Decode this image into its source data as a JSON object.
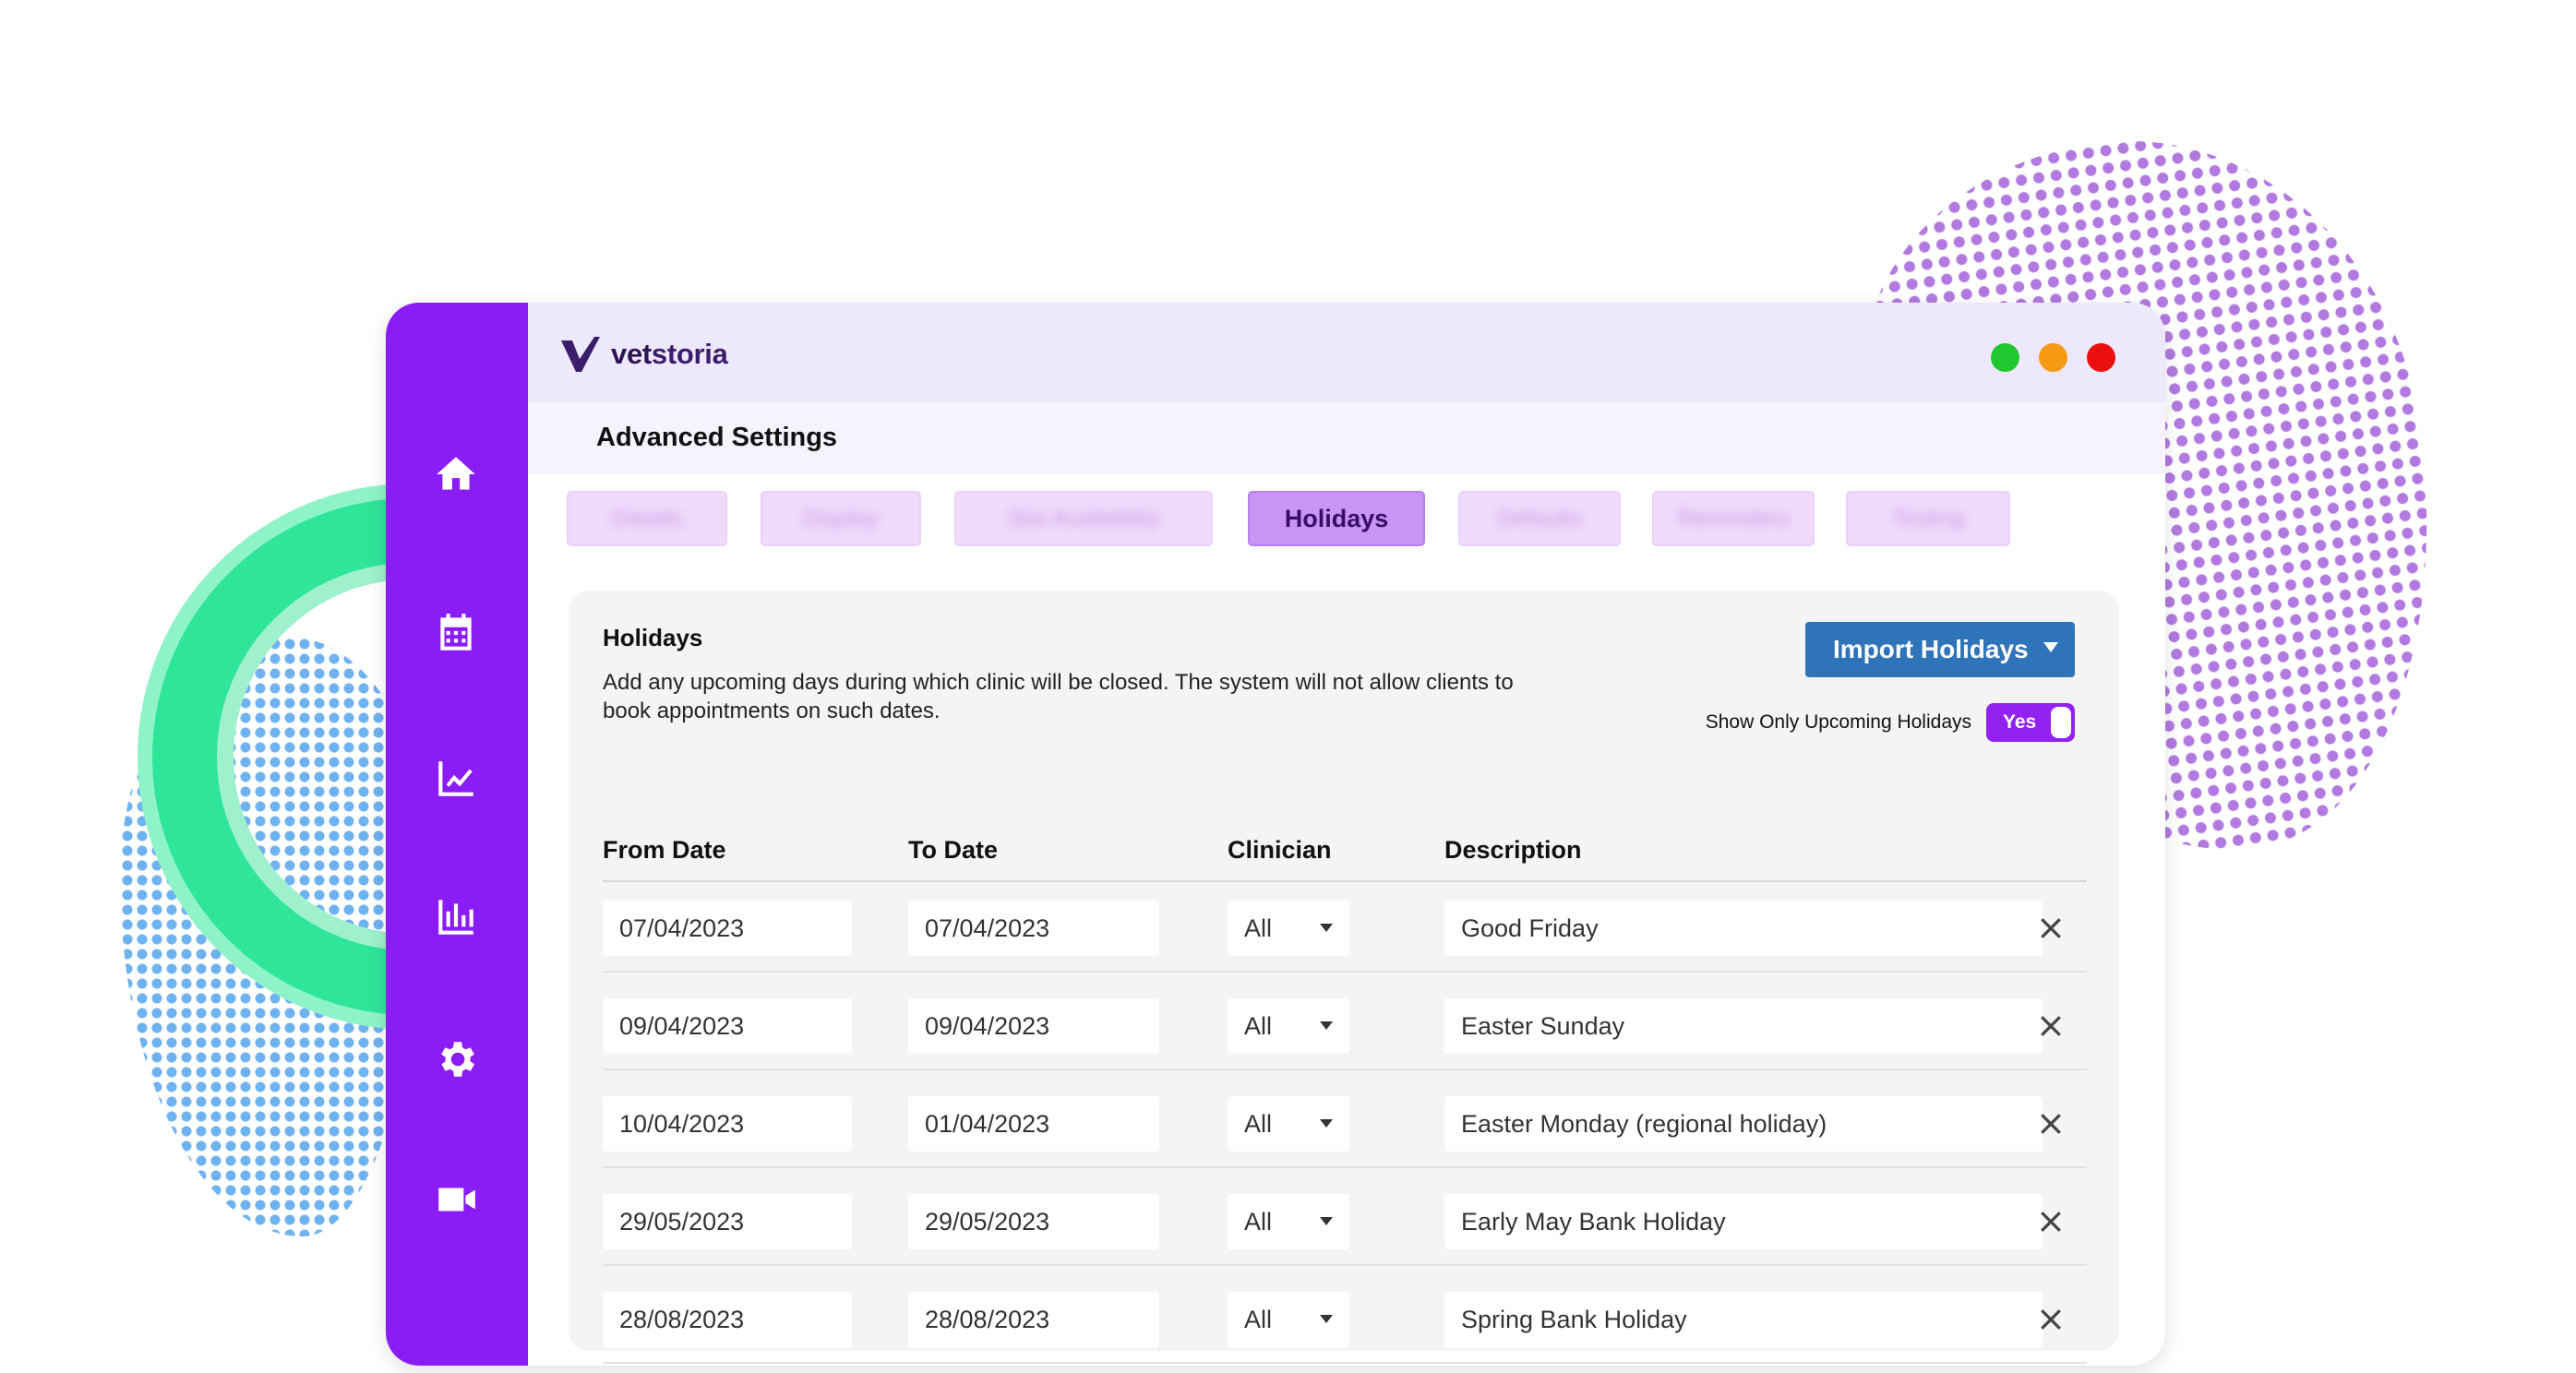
{
  "app": {
    "brand_pre": "vet",
    "brand_post": "storia"
  },
  "window_controls": [
    {
      "name": "green",
      "color": "#20c72f"
    },
    {
      "name": "orange",
      "color": "#f59a12"
    },
    {
      "name": "red",
      "color": "#ea1010"
    }
  ],
  "sidebar": {
    "items": [
      {
        "icon": "home-icon"
      },
      {
        "icon": "calendar-icon"
      },
      {
        "icon": "analytics-icon"
      },
      {
        "icon": "bar-chart-icon"
      },
      {
        "icon": "gear-icon"
      },
      {
        "icon": "video-icon"
      }
    ]
  },
  "page": {
    "title": "Advanced Settings"
  },
  "tabs": [
    {
      "label": "Details",
      "active": false
    },
    {
      "label": "Display",
      "active": false
    },
    {
      "label": "Slot Availability",
      "active": false
    },
    {
      "label": "Holidays",
      "active": true
    },
    {
      "label": "Defaults",
      "active": false
    },
    {
      "label": "Reminders",
      "active": false
    },
    {
      "label": "Testing",
      "active": false
    }
  ],
  "holidays": {
    "title": "Holidays",
    "description": "Add any upcoming days during which clinic will be closed. The system will not allow clients to book appointments on such dates.",
    "import_button": "Import Holidays",
    "upcoming_label": "Show Only Upcoming Holidays",
    "upcoming_toggle": "Yes",
    "columns": {
      "from": "From Date",
      "to": "To Date",
      "clinician": "Clinician",
      "description": "Description"
    },
    "rows": [
      {
        "from": "07/04/2023",
        "to": "07/04/2023",
        "clinician": "All",
        "description": "Good Friday"
      },
      {
        "from": "09/04/2023",
        "to": "09/04/2023",
        "clinician": "All",
        "description": "Easter Sunday"
      },
      {
        "from": "10/04/2023",
        "to": "01/04/2023",
        "clinician": "All",
        "description": "Easter Monday (regional holiday)"
      },
      {
        "from": "29/05/2023",
        "to": "29/05/2023",
        "clinician": "All",
        "description": "Early May Bank Holiday"
      },
      {
        "from": "28/08/2023",
        "to": "28/08/2023",
        "clinician": "All",
        "description": "Spring Bank Holiday"
      }
    ]
  },
  "colors": {
    "sidebar": "#8a1cf5",
    "accent_button": "#2f73b9",
    "toggle": "#9222ef",
    "active_tab": "#c995f5"
  }
}
